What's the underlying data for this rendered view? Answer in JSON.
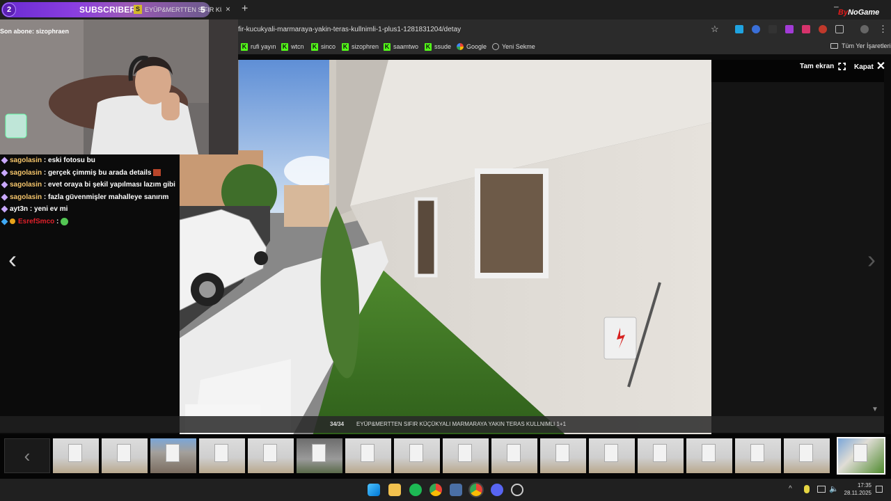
{
  "tab": {
    "subscriber_count_left": "2",
    "subscribers_label": "SUBSCRIBERS",
    "subscriber_tag": "S",
    "title": "EYÜP&MERTTEN SIFIR KÜÇÜKY",
    "subscriber_count_right": "5",
    "close": "×",
    "new_tab": "+",
    "bynogame_prefix": "By",
    "bynogame_suffix": "NoGame"
  },
  "address": {
    "url": "fir-kucukyali-marmaraya-yakin-teras-kullnimli-1-plus1-1281831204/detay"
  },
  "bookmarks": [
    {
      "label": "rufi yayın",
      "icon": "kick-icon"
    },
    {
      "label": "wtcn",
      "icon": "kick-icon"
    },
    {
      "label": "sinco",
      "icon": "kick-icon"
    },
    {
      "label": "sizophren",
      "icon": "kick-icon"
    },
    {
      "label": "saamtwo",
      "icon": "kick-icon"
    },
    {
      "label": "ssude",
      "icon": "kick-icon"
    },
    {
      "label": "Google",
      "icon": "google-icon"
    },
    {
      "label": "Yeni Sekme",
      "icon": "globe-icon"
    }
  ],
  "all_bookmarks": "Tüm Yer İşaretleri",
  "stream": {
    "last_sub": "Son abone: sizophraen"
  },
  "chat": [
    {
      "user": "sagolasin",
      "text": ": eski fotosu bu"
    },
    {
      "user": "sagolasin",
      "text": ": gerçek çimmiş bu arada details"
    },
    {
      "user": "sagolasin",
      "text": ": evet oraya bi şekil yapılması lazım gibi"
    },
    {
      "user": "sagolasin",
      "text": ": fazla güvenmişler mahalleye sanırım"
    },
    {
      "user": "ayt3n",
      "text": ": yeni ev mi"
    },
    {
      "user": "EsrefSmco",
      "text": ":"
    }
  ],
  "viewer": {
    "fullscreen_label": "Tam ekran",
    "close_label": "Kapat",
    "counter": "34/34",
    "caption": "EYÜP&MERTTEN SIFIR KÜÇÜKYALI MARMARAYA YAKIN TERAS KULLNIMLI 1+1",
    "prev": "‹",
    "next": "›"
  },
  "taskbar": {
    "time": "17:35",
    "date": "28.11.2025"
  }
}
